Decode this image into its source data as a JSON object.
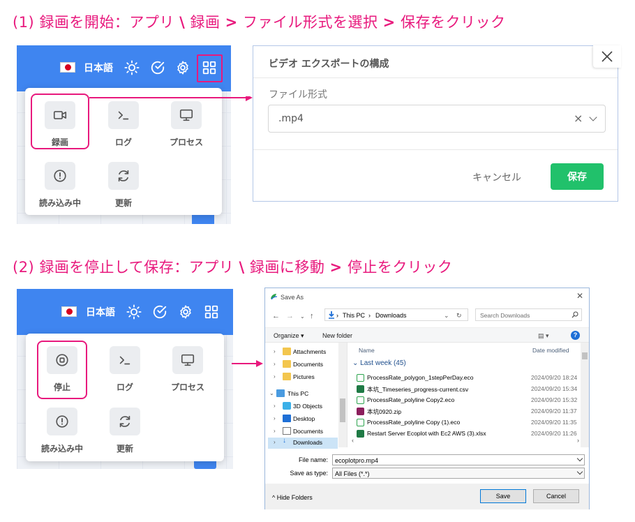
{
  "step1": {
    "title_num": "(1)",
    "title_text": "録画を開始：アプリ",
    "sep1": "\\",
    "title_text2": "録画",
    "gt1": ">",
    "title_text3": "ファイル形式を選択",
    "gt2": ">",
    "title_text4": "保存をクリック"
  },
  "step2": {
    "title_num": "(2)",
    "title_text": "録画を停止して保存：アプリ",
    "sep1": "\\",
    "title_text2": "録画に移動",
    "gt1": ">",
    "title_text3": "停止をクリック"
  },
  "header": {
    "language": "日本語"
  },
  "menu1": {
    "tiles": [
      {
        "label": "録画",
        "icon": "video-camera-icon"
      },
      {
        "label": "ログ",
        "icon": "terminal-icon"
      },
      {
        "label": "プロセス",
        "icon": "monitor-icon"
      },
      {
        "label": "読み込み中",
        "icon": "alert-circle-icon"
      },
      {
        "label": "更新",
        "icon": "refresh-icon"
      }
    ]
  },
  "menu2": {
    "tiles": [
      {
        "label": "停止",
        "icon": "stop-circle-icon"
      },
      {
        "label": "ログ",
        "icon": "terminal-icon"
      },
      {
        "label": "プロセス",
        "icon": "monitor-icon"
      },
      {
        "label": "読み込み中",
        "icon": "alert-circle-icon"
      },
      {
        "label": "更新",
        "icon": "refresh-icon"
      }
    ]
  },
  "video_dialog": {
    "title": "ビデオ エクスポートの構成",
    "field_label": "ファイル形式",
    "selected_format": ".mp4",
    "clear_symbol": "×",
    "cancel_label": "キャンセル",
    "save_label": "保存"
  },
  "save_as": {
    "title": "Save As",
    "address": [
      "This PC",
      "Downloads"
    ],
    "search_placeholder": "Search Downloads",
    "organize_label": "Organize ▾",
    "new_folder_label": "New folder",
    "nav_items": [
      {
        "label": "Attachments",
        "icon": "folder-icon"
      },
      {
        "label": "Documents",
        "icon": "folder-icon"
      },
      {
        "label": "Pictures",
        "icon": "folder-icon"
      },
      {
        "label": "This PC",
        "icon": "computer-icon"
      },
      {
        "label": "3D Objects",
        "icon": "cube-icon"
      },
      {
        "label": "Desktop",
        "icon": "desktop-icon"
      },
      {
        "label": "Documents",
        "icon": "documents-icon"
      },
      {
        "label": "Downloads",
        "icon": "download-icon"
      }
    ],
    "col_name": "Name",
    "col_date": "Date modified",
    "group_label": "Last week (45)",
    "files": [
      {
        "name": "ProcessRate_polygon_1stepPerDay.eco",
        "date": "2024/09/20 18:24",
        "icon": "eco-file-icon"
      },
      {
        "name": "本坑_Timeseries_progress-current.csv",
        "date": "2024/09/20 15:34",
        "icon": "excel-file-icon"
      },
      {
        "name": "ProcessRate_polyline Copy2.eco",
        "date": "2024/09/20 15:32",
        "icon": "eco-file-icon"
      },
      {
        "name": "本坑0920.zip",
        "date": "2024/09/20 11:37",
        "icon": "zip-file-icon"
      },
      {
        "name": "ProcessRate_polyline  Copy (1).eco",
        "date": "2024/09/20 11:35",
        "icon": "eco-file-icon"
      },
      {
        "name": "Restart Server Ecoplot with Ec2 AWS (3).xlsx",
        "date": "2024/09/20 11:26",
        "icon": "excel-file-icon"
      }
    ],
    "file_name_label": "File name:",
    "file_name_value": "ecoplotpro.mp4",
    "save_type_label": "Save as type:",
    "save_type_value": "All Files (*.*)",
    "hide_folders_label": "Hide Folders",
    "save_label": "Save",
    "cancel_label": "Cancel"
  }
}
